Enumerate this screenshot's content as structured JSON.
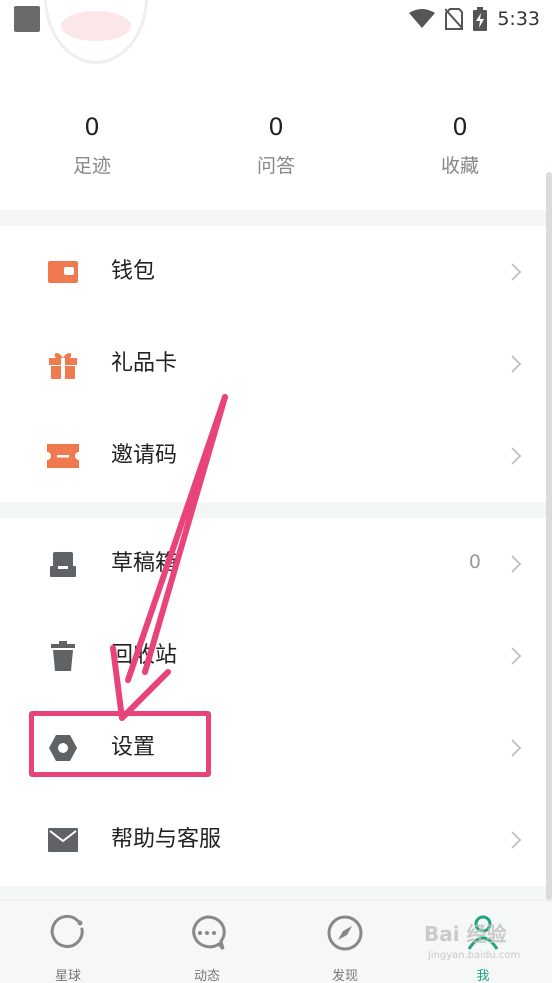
{
  "status_bar": {
    "time": "5:33"
  },
  "stats": [
    {
      "count": "0",
      "label": "足迹"
    },
    {
      "count": "0",
      "label": "问答"
    },
    {
      "count": "0",
      "label": "收藏"
    }
  ],
  "menu_group_1": [
    {
      "label": "钱包",
      "icon": "wallet-icon"
    },
    {
      "label": "礼品卡",
      "icon": "gift-icon"
    },
    {
      "label": "邀请码",
      "icon": "ticket-icon"
    }
  ],
  "menu_group_2": [
    {
      "label": "草稿箱",
      "icon": "drafts-icon",
      "count": "0"
    },
    {
      "label": "回收站",
      "icon": "trash-icon"
    },
    {
      "label": "设置",
      "icon": "settings-icon"
    },
    {
      "label": "帮助与客服",
      "icon": "mail-icon"
    }
  ],
  "bottom_nav": [
    {
      "label": "星球",
      "icon": "planet-icon"
    },
    {
      "label": "动态",
      "icon": "chat-bubble-icon"
    },
    {
      "label": "发现",
      "icon": "compass-icon"
    },
    {
      "label": "我",
      "icon": "profile-icon",
      "active": true
    }
  ],
  "watermark": {
    "text": "Bai 经验",
    "sub": "jingyan.baidu.com"
  },
  "colors": {
    "accent": "#1ea582",
    "menu_icon_orange": "#f07a50",
    "menu_icon_gray": "#5f6366",
    "annotation": "#e8437a"
  }
}
